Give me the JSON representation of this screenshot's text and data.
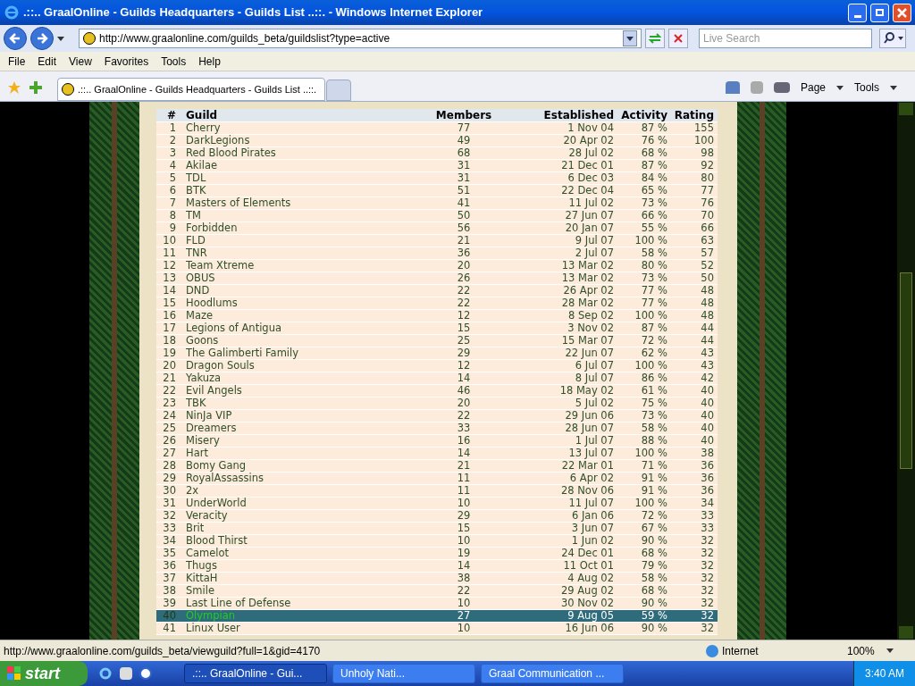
{
  "window": {
    "title": ".::.. GraalOnline - Guilds Headquarters - Guilds List ..::. - Windows Internet Explorer"
  },
  "address_bar": {
    "value": "http://www.graalonline.com/guilds_beta/guildslist?type=active"
  },
  "search": {
    "placeholder": "Live Search"
  },
  "menu": [
    "File",
    "Edit",
    "View",
    "Favorites",
    "Tools",
    "Help"
  ],
  "tabs": [
    {
      "label": ".::.. GraalOnline - Guilds Headquarters - Guilds List ..::.",
      "selected": true
    }
  ],
  "command_bar": [
    "Page",
    "Tools"
  ],
  "table": {
    "columns": [
      "#",
      "Guild",
      "Members",
      "Established",
      "Activity",
      "Rating"
    ],
    "rows": [
      {
        "cells": [
          "1",
          "Cherry",
          "77",
          "1 Nov 04",
          "87 %",
          "155"
        ],
        "selected": false
      },
      {
        "cells": [
          "2",
          "DarkLegions",
          "49",
          "20 Apr 02",
          "76 %",
          "100"
        ],
        "selected": false
      },
      {
        "cells": [
          "3",
          "Red Blood Pirates",
          "68",
          "28 Jul 02",
          "68 %",
          "98"
        ],
        "selected": false
      },
      {
        "cells": [
          "4",
          "Akilae",
          "31",
          "21 Dec 01",
          "87 %",
          "92"
        ],
        "selected": false
      },
      {
        "cells": [
          "5",
          "TDL",
          "31",
          "6 Dec 03",
          "84 %",
          "80"
        ],
        "selected": false
      },
      {
        "cells": [
          "6",
          "BTK",
          "51",
          "22 Dec 04",
          "65 %",
          "77"
        ],
        "selected": false
      },
      {
        "cells": [
          "7",
          "Masters of Elements",
          "41",
          "11 Jul 02",
          "73 %",
          "76"
        ],
        "selected": false
      },
      {
        "cells": [
          "8",
          "TM",
          "50",
          "27 Jun 07",
          "66 %",
          "70"
        ],
        "selected": false
      },
      {
        "cells": [
          "9",
          "Forbidden",
          "56",
          "20 Jan 07",
          "55 %",
          "66"
        ],
        "selected": false
      },
      {
        "cells": [
          "10",
          "FLD",
          "21",
          "9 Jul 07",
          "100 %",
          "63"
        ],
        "selected": false
      },
      {
        "cells": [
          "11",
          "TNR",
          "36",
          "2 Jul 07",
          "58 %",
          "57"
        ],
        "selected": false
      },
      {
        "cells": [
          "12",
          "Team Xtreme",
          "20",
          "13 Mar 02",
          "80 %",
          "52"
        ],
        "selected": false
      },
      {
        "cells": [
          "13",
          "OBUS",
          "26",
          "13 Mar 02",
          "73 %",
          "50"
        ],
        "selected": false
      },
      {
        "cells": [
          "14",
          "DND",
          "22",
          "26 Apr 02",
          "77 %",
          "48"
        ],
        "selected": false
      },
      {
        "cells": [
          "15",
          "Hoodlums",
          "22",
          "28 Mar 02",
          "77 %",
          "48"
        ],
        "selected": false
      },
      {
        "cells": [
          "16",
          "Maze",
          "12",
          "8 Sep 02",
          "100 %",
          "48"
        ],
        "selected": false
      },
      {
        "cells": [
          "17",
          "Legions of Antigua",
          "15",
          "3 Nov 02",
          "87 %",
          "44"
        ],
        "selected": false
      },
      {
        "cells": [
          "18",
          "Goons",
          "25",
          "15 Mar 07",
          "72 %",
          "44"
        ],
        "selected": false
      },
      {
        "cells": [
          "19",
          "The Galimberti Family",
          "29",
          "22 Jun 07",
          "62 %",
          "43"
        ],
        "selected": false
      },
      {
        "cells": [
          "20",
          "Dragon Souls",
          "12",
          "6 Jul 07",
          "100 %",
          "43"
        ],
        "selected": false
      },
      {
        "cells": [
          "21",
          "Yakuza",
          "14",
          "8 Jul 07",
          "86 %",
          "42"
        ],
        "selected": false
      },
      {
        "cells": [
          "22",
          "Evil Angels",
          "46",
          "18 May 02",
          "61 %",
          "40"
        ],
        "selected": false
      },
      {
        "cells": [
          "23",
          "TBK",
          "20",
          "5 Jul 02",
          "75 %",
          "40"
        ],
        "selected": false
      },
      {
        "cells": [
          "24",
          "NinJa VIP",
          "22",
          "29 Jun 06",
          "73 %",
          "40"
        ],
        "selected": false
      },
      {
        "cells": [
          "25",
          "Dreamers",
          "33",
          "28 Jun 07",
          "58 %",
          "40"
        ],
        "selected": false
      },
      {
        "cells": [
          "26",
          "Misery",
          "16",
          "1 Jul 07",
          "88 %",
          "40"
        ],
        "selected": false
      },
      {
        "cells": [
          "27",
          "Hart",
          "14",
          "13 Jul 07",
          "100 %",
          "38"
        ],
        "selected": false
      },
      {
        "cells": [
          "28",
          "Bomy Gang",
          "21",
          "22 Mar 01",
          "71 %",
          "36"
        ],
        "selected": false
      },
      {
        "cells": [
          "29",
          "RoyalAssassins",
          "11",
          "6 Apr 02",
          "91 %",
          "36"
        ],
        "selected": false
      },
      {
        "cells": [
          "30",
          "2x",
          "11",
          "28 Nov 06",
          "91 %",
          "36"
        ],
        "selected": false
      },
      {
        "cells": [
          "31",
          "UnderWorld",
          "10",
          "11 Jul 07",
          "100 %",
          "34"
        ],
        "selected": false
      },
      {
        "cells": [
          "32",
          "Veracity",
          "29",
          "6 Jan 06",
          "72 %",
          "33"
        ],
        "selected": false
      },
      {
        "cells": [
          "33",
          "Brit",
          "15",
          "3 Jun 07",
          "67 %",
          "33"
        ],
        "selected": false
      },
      {
        "cells": [
          "34",
          "Blood Thirst",
          "10",
          "1 Jun 02",
          "90 %",
          "32"
        ],
        "selected": false
      },
      {
        "cells": [
          "35",
          "Camelot",
          "19",
          "24 Dec 01",
          "68 %",
          "32"
        ],
        "selected": false
      },
      {
        "cells": [
          "36",
          "Thugs",
          "14",
          "11 Oct 01",
          "79 %",
          "32"
        ],
        "selected": false
      },
      {
        "cells": [
          "37",
          "KittaH",
          "38",
          "4 Aug 02",
          "58 %",
          "32"
        ],
        "selected": false
      },
      {
        "cells": [
          "38",
          "Smile",
          "22",
          "29 Aug 02",
          "68 %",
          "32"
        ],
        "selected": false
      },
      {
        "cells": [
          "39",
          "Last Line of Defense",
          "10",
          "30 Nov 02",
          "90 %",
          "32"
        ],
        "selected": false
      },
      {
        "cells": [
          "40",
          "Olympian",
          "27",
          "9 Aug 05",
          "59 %",
          "32"
        ],
        "selected": true
      },
      {
        "cells": [
          "41",
          "Linux User",
          "10",
          "16 Jun 06",
          "90 %",
          "32"
        ],
        "selected": false
      }
    ]
  },
  "status_bar": {
    "text": "http://www.graalonline.com/guilds_beta/viewguild?full=1&gid=4170",
    "zone": "Internet",
    "zoom": "100%"
  },
  "taskbar": {
    "start": "start",
    "tasks": [
      {
        "label": ".::.. GraalOnline - Gui...",
        "selected": true
      },
      {
        "label": "Unholy Nati...",
        "selected": false
      },
      {
        "label": "Graal Communication ...",
        "selected": false
      }
    ],
    "clock": "3:40 AM"
  }
}
